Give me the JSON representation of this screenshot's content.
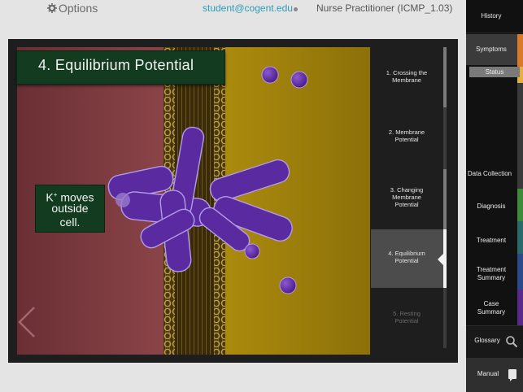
{
  "top_bar": {
    "options_label": "Options",
    "user_email": "student@cogent.edu",
    "course_title": "Nurse Practitioner (ICMP_1.03)"
  },
  "slide": {
    "title": "4.  Equilibrium Potential",
    "callout_line1": "K",
    "callout_superscript": "+",
    "callout_line1_rest": " moves",
    "callout_line2": "outside",
    "callout_line3": "cell."
  },
  "steps": [
    {
      "line1": "1. Crossing the",
      "line2": "Membrane",
      "line3": ""
    },
    {
      "line1": "2. Membrane",
      "line2": "Potential",
      "line3": ""
    },
    {
      "line1": "3. Changing",
      "line2": "Membrane",
      "line3": "Potential"
    },
    {
      "line1": "4. Equilibrium",
      "line2": "Potential",
      "line3": ""
    },
    {
      "line1": "5. Resting",
      "line2": "Potential",
      "line3": ""
    }
  ],
  "sidebar": {
    "items": [
      "History",
      "Symptoms",
      "Status",
      "Data Collection",
      "Diagnosis",
      "Treatment",
      "Treatment Summary",
      "Case Summary",
      "Glossary",
      "Manual"
    ],
    "treatment_summary_line1": "Treatment",
    "treatment_summary_line2": "Summary",
    "case_summary_line1": "Case",
    "case_summary_line2": "Summary"
  },
  "colors": {
    "link": "#2a9db8",
    "label_bg": "#123b1f",
    "intracellular": "#7a3a3e",
    "extracellular": "#a88a10",
    "channel": "#6a2fb0",
    "stripe_orange": "#d87a2a",
    "stripe_green": "#3c8a3a",
    "stripe_teal": "#2a6a6a",
    "stripe_blue": "#2a4a8a",
    "stripe_purple": "#5a2a8a"
  }
}
